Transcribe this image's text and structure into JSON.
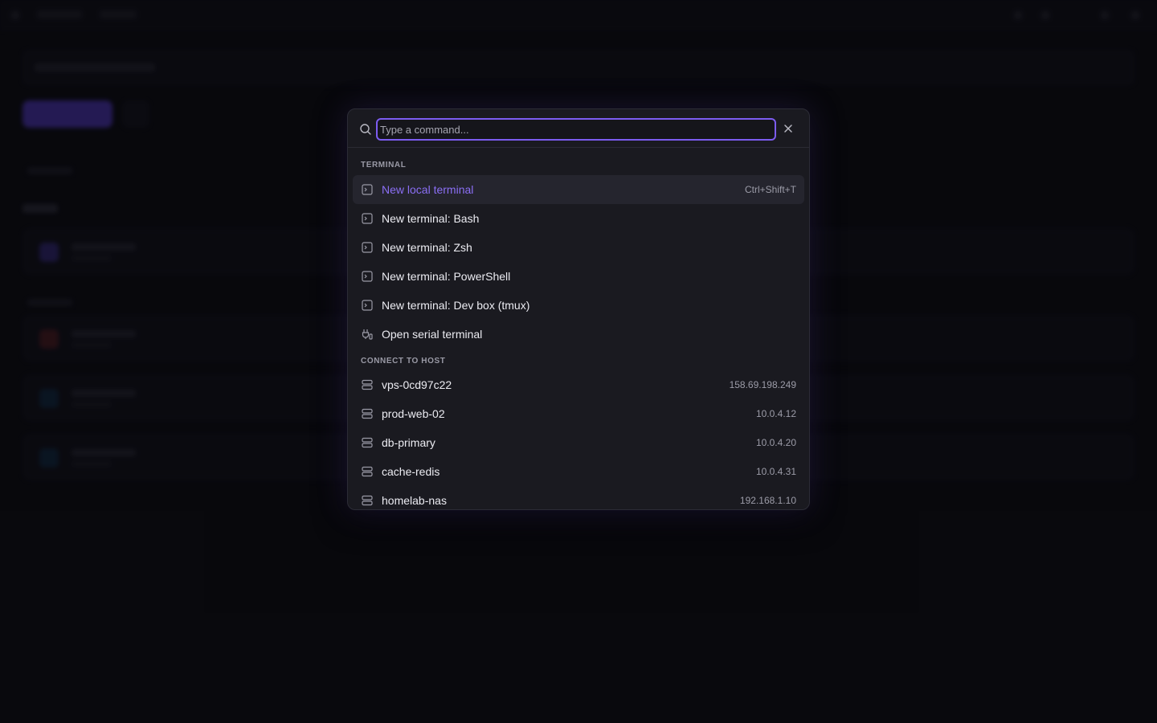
{
  "palette": {
    "search_placeholder": "Type a command...",
    "search_value": "",
    "sections": [
      {
        "label": "TERMINAL",
        "items": [
          {
            "label": "New local terminal",
            "meta": "Ctrl+Shift+T",
            "icon": "terminal-icon",
            "active": true
          },
          {
            "label": "New terminal: Bash",
            "meta": "",
            "icon": "terminal-icon"
          },
          {
            "label": "New terminal: Zsh",
            "meta": "",
            "icon": "terminal-icon"
          },
          {
            "label": "New terminal: PowerShell",
            "meta": "",
            "icon": "terminal-icon"
          },
          {
            "label": "New terminal: Dev box (tmux)",
            "meta": "",
            "icon": "terminal-icon"
          },
          {
            "label": "Open serial terminal",
            "meta": "",
            "icon": "serial-port-icon"
          }
        ]
      },
      {
        "label": "CONNECT TO HOST",
        "items": [
          {
            "label": "vps-0cd97c22",
            "meta": "158.69.198.249",
            "icon": "server-icon"
          },
          {
            "label": "prod-web-02",
            "meta": "10.0.4.12",
            "icon": "server-icon"
          },
          {
            "label": "db-primary",
            "meta": "10.0.4.20",
            "icon": "server-icon"
          },
          {
            "label": "cache-redis",
            "meta": "10.0.4.31",
            "icon": "server-icon"
          },
          {
            "label": "homelab-nas",
            "meta": "192.168.1.10",
            "icon": "server-icon"
          }
        ]
      }
    ]
  },
  "colors": {
    "accent": "#7c5cf0",
    "active_text": "#8b6ff5",
    "palette_bg": "#1a1a20",
    "page_bg": "#0b0b0f"
  }
}
